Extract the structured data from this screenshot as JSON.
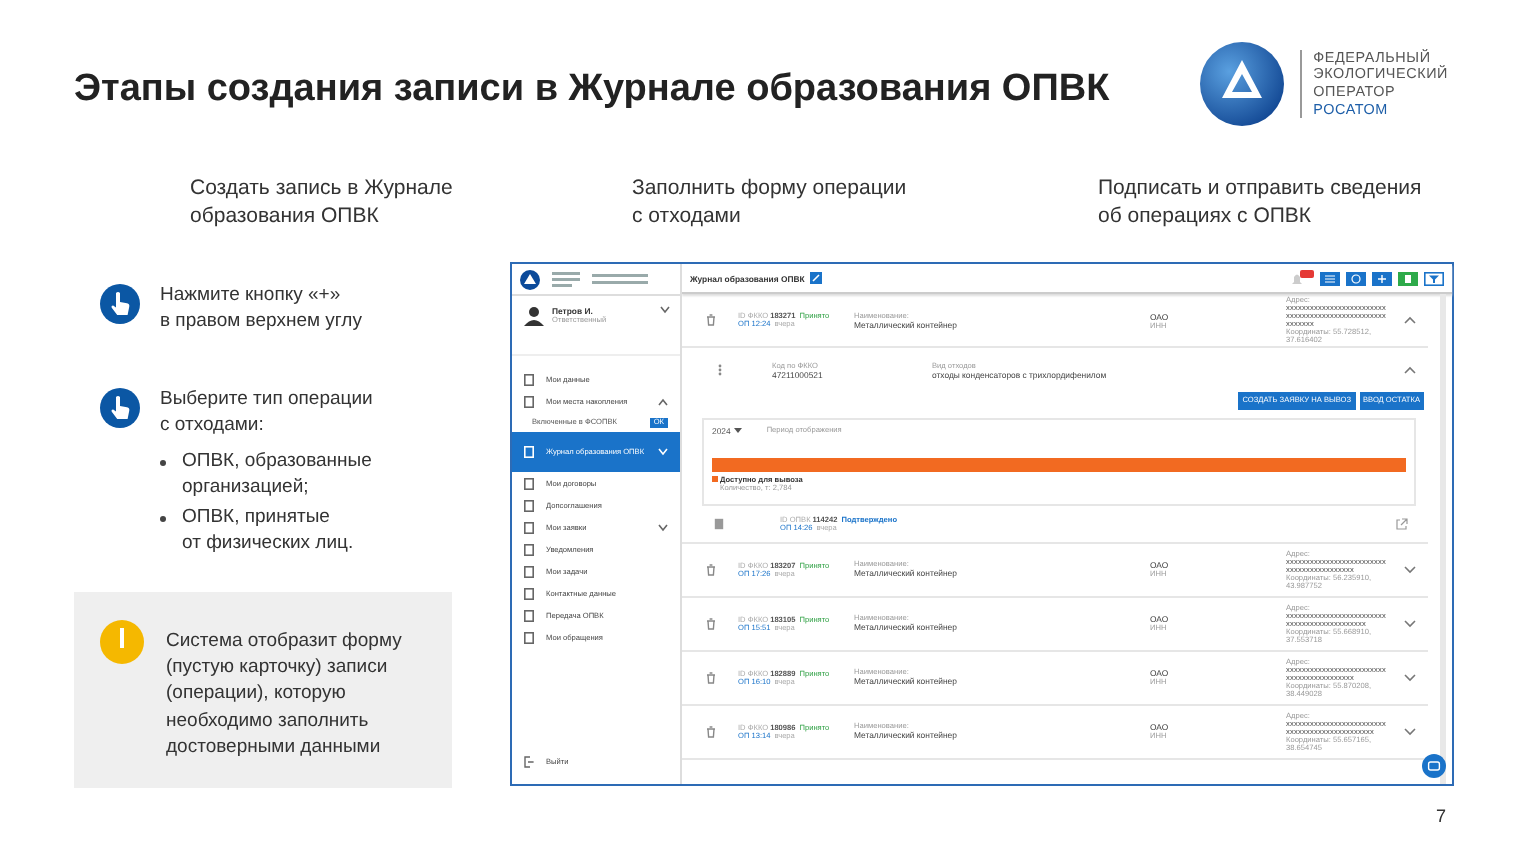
{
  "slide": {
    "title": "Этапы создания записи в Журнале образования ОПВК",
    "logo_lines": [
      "ФЕДЕРАЛЬНЫЙ",
      "ЭКОЛОГИЧЕСКИЙ",
      "ОПЕРАТОР",
      "РОСАТОМ"
    ],
    "page_number": "7"
  },
  "steps": [
    "Создать запись в Журнале\nобразования ОПВК",
    "Заполнить форму операции\nс отходами",
    "Подписать и отправить сведения\nоб операциях с ОПВК"
  ],
  "instructions": [
    {
      "kind": "step",
      "text": "Нажмите кнопку «+»\nв правом верхнем углу"
    },
    {
      "kind": "step",
      "text": "Выберите тип операции\nс отходами:",
      "bullets": [
        "ОПВК, образованные\nорганизацией;",
        "ОПВК, принятые\nот физических лиц."
      ]
    },
    {
      "kind": "note",
      "text": "Система отобразит форму\n(пустую карточку) записи\n(операции), которую\nнеобходимо заполнить\nдостоверными данными"
    }
  ],
  "app": {
    "header_title": "Журнал образования ОПВК",
    "user": {
      "name": "Петров И.",
      "role": "Ответственный"
    },
    "nav": [
      {
        "label": "Мои данные",
        "selected": false
      },
      {
        "label": "Мои места накопления",
        "selected": false,
        "expanded": true,
        "children": [
          {
            "label": "Включенные в ФСОПВК",
            "badge": "ОК"
          }
        ]
      },
      {
        "label": "Журнал образования ОПВК",
        "selected": true,
        "expanded": false
      },
      {
        "label": "Мои договоры",
        "selected": false
      },
      {
        "label": "Допсоглашения",
        "selected": false
      },
      {
        "label": "Мои заявки",
        "selected": false,
        "expanded": false
      },
      {
        "label": "Уведомления",
        "selected": false
      },
      {
        "label": "Мои задачи",
        "selected": false
      },
      {
        "label": "Контактные данные",
        "selected": false
      },
      {
        "label": "Передача ОПВК",
        "selected": false
      },
      {
        "label": "Мои обращения",
        "selected": false
      }
    ],
    "logout": "Выйти",
    "records": [
      {
        "id_label": "ID ФККО",
        "id": "183271",
        "status": "Принято",
        "time": "ОП 12:24",
        "when": "вчера",
        "name_label": "Наименование:",
        "name": "Металлический контейнер",
        "org": "ОАО",
        "org_sub": "ИНН",
        "addr_label": "Адрес:",
        "addr": [
          "xxxxxxxxxxxxxxxxxxxxxxxxx",
          "xxxxxxxxxxxxxxxxxxxxxxxxx",
          "xxxxxxx"
        ],
        "coords": "Координаты: 55.728512, 37.616402",
        "expanded": true,
        "detail": {
          "code_label": "Код по ФККО",
          "code": "47211000521",
          "waste_label": "Вид отходов",
          "waste": "отходы конденсаторов с трихлордифенилом",
          "buttons": [
            "СОЗДАТЬ ЗАЯВКУ НА ВЫВОЗ",
            "ВВОД ОСТАТКА"
          ],
          "year": "2024",
          "period_label": "Период отображения",
          "level": 1,
          "legend": "Доступно для вывоза",
          "amount": "Количество, т: 2,784",
          "sub": {
            "id_label": "ID ОПВК",
            "id": "114242",
            "status": "Подтверждено",
            "time": "ОП 14:26",
            "when": "вчера"
          }
        }
      },
      {
        "id_label": "ID ФККО",
        "id": "183207",
        "status": "Принято",
        "time": "ОП 17:26",
        "when": "вчера",
        "name_label": "Наименование:",
        "name": "Металлический контейнер",
        "org": "ОАО",
        "org_sub": "ИНН",
        "addr_label": "Адрес:",
        "addr": [
          "xxxxxxxxxxxxxxxxxxxxxxxxx",
          "xxxxxxxxxxxxxxxxx"
        ],
        "coords": "Координаты: 56.235910, 43.987752",
        "expanded": false
      },
      {
        "id_label": "ID ФККО",
        "id": "183105",
        "status": "Принято",
        "time": "ОП 15:51",
        "when": "вчера",
        "name_label": "Наименование:",
        "name": "Металлический контейнер",
        "org": "ОАО",
        "org_sub": "ИНН",
        "addr_label": "Адрес:",
        "addr": [
          "xxxxxxxxxxxxxxxxxxxxxxxxx",
          "xxxxxxxxxxxxxxxxxxxx"
        ],
        "coords": "Координаты: 55.668910, 37.553718",
        "expanded": false
      },
      {
        "id_label": "ID ФККО",
        "id": "182889",
        "status": "Принято",
        "time": "ОП 16:10",
        "when": "вчера",
        "name_label": "Наименование:",
        "name": "Металлический контейнер",
        "org": "ОАО",
        "org_sub": "ИНН",
        "addr_label": "Адрес:",
        "addr": [
          "xxxxxxxxxxxxxxxxxxxxxxxxx",
          "xxxxxxxxxxxxxxxxx"
        ],
        "coords": "Координаты: 55.870208, 38.449028",
        "expanded": false
      },
      {
        "id_label": "ID ФККО",
        "id": "180986",
        "status": "Принято",
        "time": "ОП 13:14",
        "when": "вчера",
        "name_label": "Наименование:",
        "name": "Металлический контейнер",
        "org": "ОАО",
        "org_sub": "ИНН",
        "addr_label": "Адрес:",
        "addr": [
          "xxxxxxxxxxxxxxxxxxxxxxxxx",
          "xxxxxxxxxxxxxxxxxxxxxx"
        ],
        "coords": "Координаты: 55.657165, 38.654745",
        "expanded": false
      }
    ]
  }
}
